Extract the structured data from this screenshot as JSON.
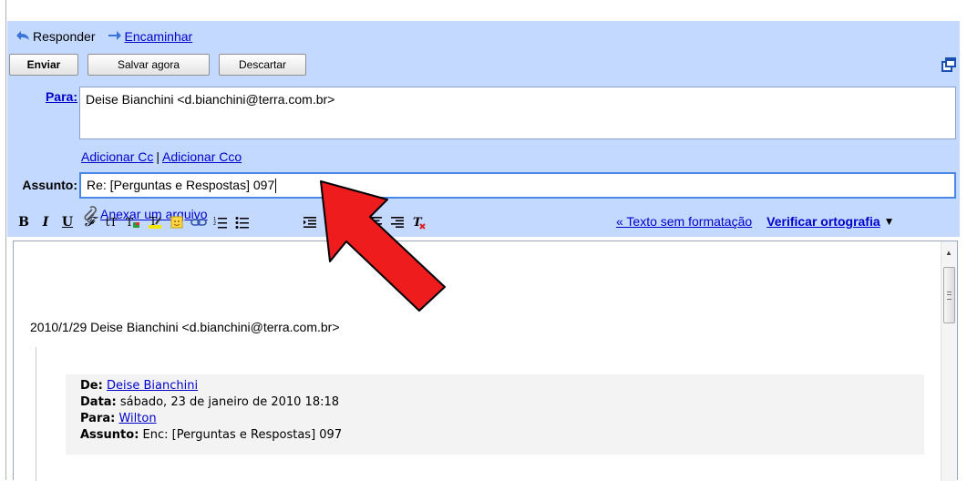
{
  "reply_bar": {
    "reply_label": "Responder",
    "forward_label": "Encaminhar"
  },
  "buttons": {
    "send": "Enviar",
    "save": "Salvar agora",
    "discard": "Descartar"
  },
  "to": {
    "label": "Para:",
    "value": "Deise Bianchini <d.bianchini@terra.com.br>"
  },
  "cc": {
    "add_cc": "Adicionar Cc",
    "separator": "|",
    "add_bcc": "Adicionar Cco"
  },
  "subject": {
    "label": "Assunto:",
    "value": "Re: [Perguntas e Respostas] 097"
  },
  "attach": {
    "label": "Anexar um arquivo"
  },
  "toolbar": {
    "plain_text": "« Texto sem formatação",
    "spellcheck": "Verificar ortografia",
    "spellcheck_caret": "▼"
  },
  "body": {
    "quote_header": "2010/1/29 Deise Bianchini <d.bianchini@terra.com.br>",
    "from_label": "De:",
    "from_value": "Deise Bianchini",
    "date_label": "Data:",
    "date_value": "sábado, 23 de janeiro de 2010 18:18",
    "to_label": "Para:",
    "to_value": "Wilton",
    "subject_label": "Assunto:",
    "subject_value": "Enc: [Perguntas e Respostas] 097"
  },
  "colors": {
    "panel_background": "#c3d9ff",
    "link": "#0000cc",
    "annotation_arrow": "#ee1c1c"
  },
  "icons": [
    "reply-arrow-icon",
    "forward-arrow-icon",
    "popout-icon",
    "paperclip-icon",
    "scroll-up-icon",
    "red-pointer-arrow"
  ]
}
